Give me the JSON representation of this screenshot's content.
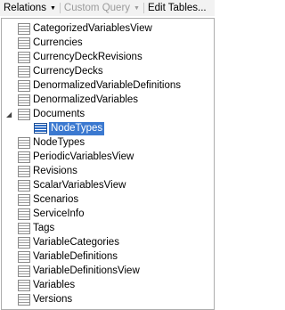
{
  "toolbar": {
    "relations": "Relations",
    "custom_query": "Custom Query",
    "edit_tables": "Edit Tables..."
  },
  "tree": {
    "items": [
      "CategorizedVariablesView",
      "Currencies",
      "CurrencyDeckRevisions",
      "CurrencyDecks",
      "DenormalizedVariableDefinitions",
      "DenormalizedVariables",
      "Documents",
      "NodeTypes",
      "NodeTypes",
      "PeriodicVariablesView",
      "Revisions",
      "ScalarVariablesView",
      "Scenarios",
      "ServiceInfo",
      "Tags",
      "VariableCategories",
      "VariableDefinitions",
      "VariableDefinitionsView",
      "Variables",
      "Versions"
    ],
    "selected_child": "NodeTypes"
  }
}
